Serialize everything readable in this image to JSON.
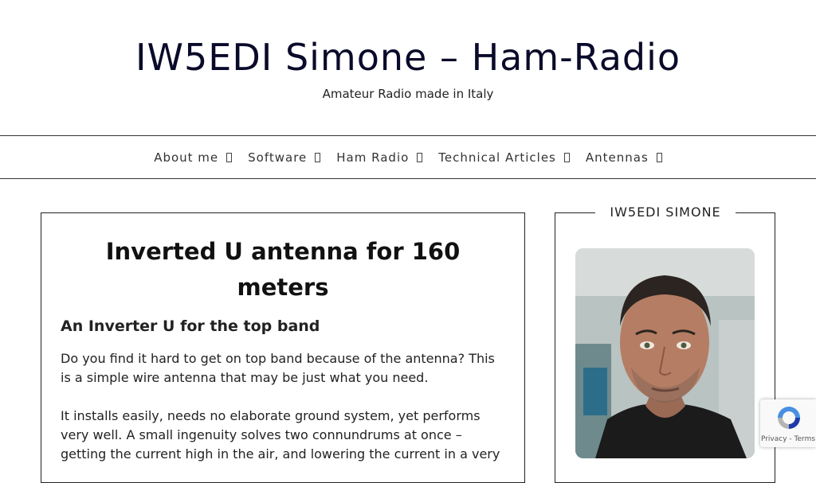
{
  "header": {
    "site_title": "IW5EDI Simone – Ham-Radio",
    "tagline": "Amateur Radio made in Italy"
  },
  "nav": {
    "items": [
      {
        "label": "About me"
      },
      {
        "label": "Software"
      },
      {
        "label": "Ham Radio"
      },
      {
        "label": "Technical Articles"
      },
      {
        "label": "Antennas"
      }
    ]
  },
  "post": {
    "title": "Inverted U antenna for 160 meters",
    "subtitle": "An Inverter U for the top band",
    "paragraphs": [
      "Do you find it hard to get on top band because of the antenna? This is a simple wire antenna that may be just what you need.",
      "It installs easily, needs no elaborate ground system, yet performs very well. A small ingenuity solves two connundrums at once – getting the current high in the air, and lowering the current in a very"
    ]
  },
  "sidebar": {
    "title": "IW5EDI SIMONE"
  },
  "recaptcha": {
    "privacy": "Privacy",
    "separator": " - ",
    "terms": "Terms"
  },
  "colors": {
    "title": "#0a0a2a",
    "border": "#222222",
    "recaptcha_blue": "#4a90e2",
    "recaptcha_dark_blue": "#1c3aa9"
  }
}
